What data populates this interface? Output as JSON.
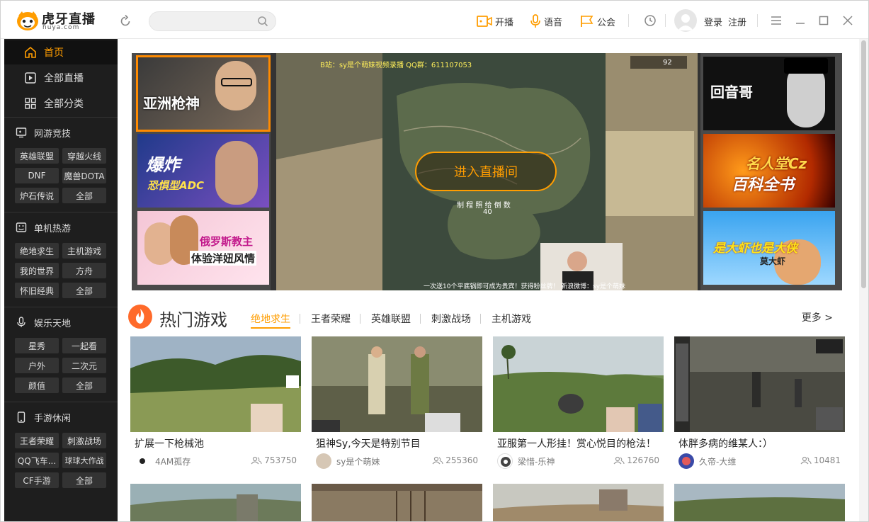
{
  "app": {
    "logo_text": "虎牙直播",
    "logo_sub": "huya.com",
    "search_placeholder": ""
  },
  "toolbar": {
    "broadcast_label": "开播",
    "voice_label": "语音",
    "guild_label": "公会",
    "login_label": "登录",
    "register_label": "注册"
  },
  "sidebar": {
    "nav": [
      {
        "label": "首页",
        "icon": "home-icon",
        "active": true
      },
      {
        "label": "全部直播",
        "icon": "play-square-icon",
        "active": false
      },
      {
        "label": "全部分类",
        "icon": "grid-icon",
        "active": false
      }
    ],
    "categories": [
      {
        "title": "网游竞技",
        "icon": "gamepad-monitor-icon",
        "tags": [
          "英雄联盟",
          "穿越火线",
          "DNF",
          "魔兽DOTA",
          "炉石传说",
          "全部"
        ]
      },
      {
        "title": "单机热游",
        "icon": "console-icon",
        "tags": [
          "绝地求生",
          "主机游戏",
          "我的世界",
          "方舟",
          "怀旧经典",
          "全部"
        ]
      },
      {
        "title": "娱乐天地",
        "icon": "microphone-icon",
        "tags": [
          "星秀",
          "一起看",
          "户外",
          "二次元",
          "颜值",
          "全部"
        ]
      },
      {
        "title": "手游休闲",
        "icon": "phone-icon",
        "tags": [
          "王者荣耀",
          "刺激战场",
          "QQ飞车...",
          "球球大作战",
          "CF手游",
          "全部"
        ]
      }
    ]
  },
  "banner": {
    "left_thumbs": [
      "亚洲枪神",
      "爆炸",
      "恐惧型ADC",
      "俄罗斯教主",
      "体验洋妞风情"
    ],
    "right_thumbs": [
      "回音哥",
      "名人堂Cz",
      "百科全书",
      "是大虾也是大侠",
      "莫大虾"
    ],
    "video_caption_top": "B站：sy是个萌妹视频录播 QQ群：611107053",
    "video_counter": "92",
    "video_countdown_label": "制 程 照 给 倒 数",
    "video_countdown_value": "40",
    "video_caption_bottom": "一次送10个平底锅即可成为贵宾！获得粉丝牌！",
    "video_weibo": "新浪微博：sy是个萌妹",
    "enter_label": "进入直播间"
  },
  "hot": {
    "title": "热门游戏",
    "tabs": [
      {
        "label": "绝地求生",
        "active": true
      },
      {
        "label": "王者荣耀",
        "active": false
      },
      {
        "label": "英雄联盟",
        "active": false
      },
      {
        "label": "刺激战场",
        "active": false
      },
      {
        "label": "主机游戏",
        "active": false
      }
    ],
    "more_label": "更多 >",
    "cards": [
      {
        "title": "扩展一下枪械池",
        "anchor": "4AM孤存",
        "viewers": "753750"
      },
      {
        "title": "狙神Sy,今天是特别节目",
        "anchor": "sy是个萌妹",
        "viewers": "255360"
      },
      {
        "title": "亚服第一人形挂！赏心悦目的枪法！",
        "anchor": "梁惜-乐神",
        "viewers": "126760"
      },
      {
        "title": "体胖多病的维某人：）",
        "anchor": "久帝-大维",
        "viewers": "10481"
      }
    ]
  },
  "colors": {
    "accent": "#ff9d00",
    "sidebar_bg": "#1e1e1e",
    "tag_bg": "#333333"
  }
}
